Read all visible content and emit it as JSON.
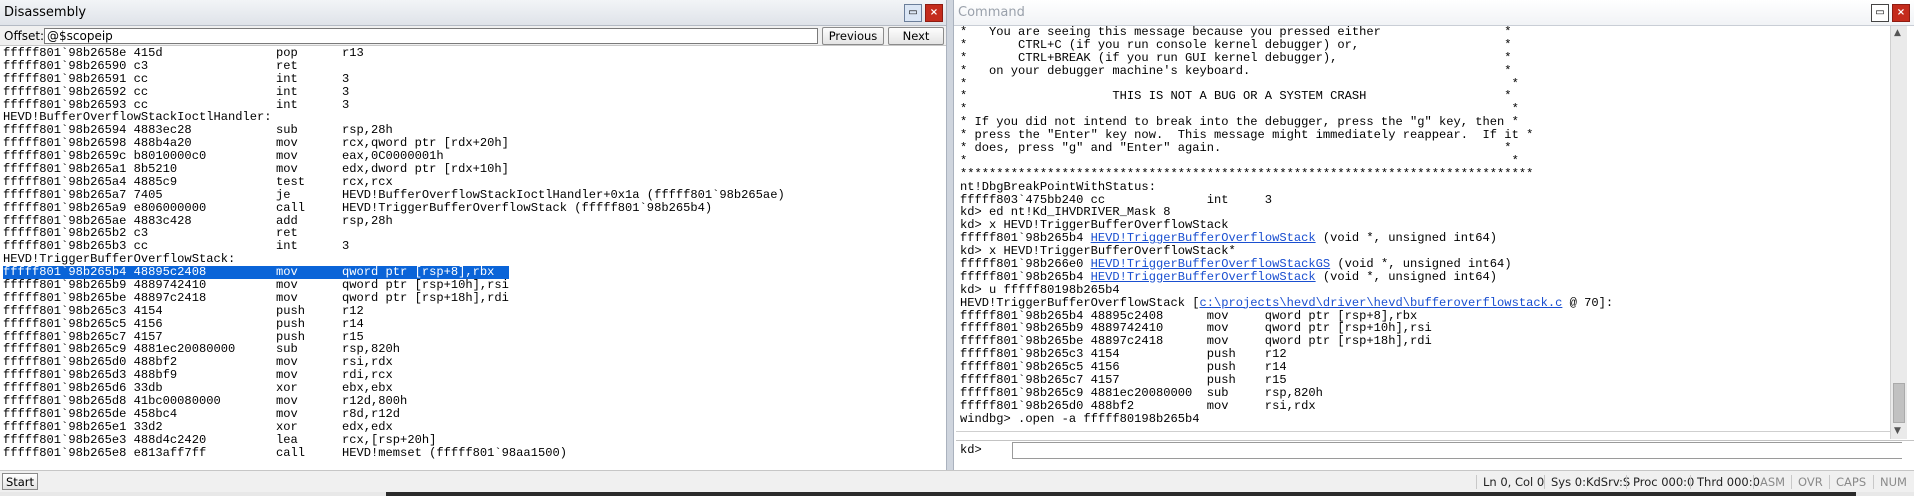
{
  "disassembly": {
    "title": "Disassembly",
    "offset_label": "Offset:",
    "offset_value": "@$scopeip",
    "prev_label": "Previous",
    "next_label": "Next",
    "dock_icon": "dock-window-icon",
    "close_icon": "close-icon",
    "lines": [
      {
        "a": "fffff801`98b2658e 415d",
        "m": "pop",
        "o": "r13"
      },
      {
        "a": "fffff801`98b26590 c3",
        "m": "ret",
        "o": ""
      },
      {
        "a": "fffff801`98b26591 cc",
        "m": "int",
        "o": "3"
      },
      {
        "a": "fffff801`98b26592 cc",
        "m": "int",
        "o": "3"
      },
      {
        "a": "fffff801`98b26593 cc",
        "m": "int",
        "o": "3"
      },
      {
        "t": "HEVD!BufferOverflowStackIoctlHandler:"
      },
      {
        "a": "fffff801`98b26594 4883ec28",
        "m": "sub",
        "o": "rsp,28h"
      },
      {
        "a": "fffff801`98b26598 488b4a20",
        "m": "mov",
        "o": "rcx,qword ptr [rdx+20h]"
      },
      {
        "a": "fffff801`98b2659c b8010000c0",
        "m": "mov",
        "o": "eax,0C0000001h"
      },
      {
        "a": "fffff801`98b265a1 8b5210",
        "m": "mov",
        "o": "edx,dword ptr [rdx+10h]"
      },
      {
        "a": "fffff801`98b265a4 4885c9",
        "m": "test",
        "o": "rcx,rcx"
      },
      {
        "a": "fffff801`98b265a7 7405",
        "m": "je",
        "o": "HEVD!BufferOverflowStackIoctlHandler+0x1a (fffff801`98b265ae)"
      },
      {
        "a": "fffff801`98b265a9 e806000000",
        "m": "call",
        "o": "HEVD!TriggerBufferOverflowStack (fffff801`98b265b4)"
      },
      {
        "a": "fffff801`98b265ae 4883c428",
        "m": "add",
        "o": "rsp,28h"
      },
      {
        "a": "fffff801`98b265b2 c3",
        "m": "ret",
        "o": ""
      },
      {
        "a": "fffff801`98b265b3 cc",
        "m": "int",
        "o": "3"
      },
      {
        "t": "HEVD!TriggerBufferOverflowStack:"
      },
      {
        "a": "fffff801`98b265b4 48895c2408",
        "m": "mov",
        "o": "qword ptr [rsp+8],rbx",
        "sel": true
      },
      {
        "a": "fffff801`98b265b9 4889742410",
        "m": "mov",
        "o": "qword ptr [rsp+10h],rsi"
      },
      {
        "a": "fffff801`98b265be 48897c2418",
        "m": "mov",
        "o": "qword ptr [rsp+18h],rdi"
      },
      {
        "a": "fffff801`98b265c3 4154",
        "m": "push",
        "o": "r12"
      },
      {
        "a": "fffff801`98b265c5 4156",
        "m": "push",
        "o": "r14"
      },
      {
        "a": "fffff801`98b265c7 4157",
        "m": "push",
        "o": "r15"
      },
      {
        "a": "fffff801`98b265c9 4881ec20080000",
        "m": "sub",
        "o": "rsp,820h"
      },
      {
        "a": "fffff801`98b265d0 488bf2",
        "m": "mov",
        "o": "rsi,rdx"
      },
      {
        "a": "fffff801`98b265d3 488bf9",
        "m": "mov",
        "o": "rdi,rcx"
      },
      {
        "a": "fffff801`98b265d6 33db",
        "m": "xor",
        "o": "ebx,ebx"
      },
      {
        "a": "fffff801`98b265d8 41bc00080000",
        "m": "mov",
        "o": "r12d,800h"
      },
      {
        "a": "fffff801`98b265de 458bc4",
        "m": "mov",
        "o": "r8d,r12d"
      },
      {
        "a": "fffff801`98b265e1 33d2",
        "m": "xor",
        "o": "edx,edx"
      },
      {
        "a": "fffff801`98b265e3 488d4c2420",
        "m": "lea",
        "o": "rcx,[rsp+20h]"
      },
      {
        "a": "fffff801`98b265e8 e813aff7ff",
        "m": "call",
        "o": "HEVD!memset (fffff801`98aa1500)"
      }
    ]
  },
  "command": {
    "title": "Command",
    "dock_icon": "dock-window-icon",
    "lines": [
      [
        {
          "t": "*   You are seeing this message because you pressed either                 *"
        }
      ],
      [
        {
          "t": "*       CTRL+C (if you run console kernel debugger) or,                    *"
        }
      ],
      [
        {
          "t": "*       CTRL+BREAK (if you run GUI kernel debugger),                       *"
        }
      ],
      [
        {
          "t": "*   on your debugger machine's keyboard.                                   *"
        }
      ],
      [
        {
          "t": "*                                                                           *"
        }
      ],
      [
        {
          "t": "*                    THIS IS NOT A BUG OR A SYSTEM CRASH                   *"
        }
      ],
      [
        {
          "t": "*                                                                           *"
        }
      ],
      [
        {
          "t": "* If you did not intend to break into the debugger, press the \"g\" key, then *"
        }
      ],
      [
        {
          "t": "* press the \"Enter\" key now.  This message might immediately reappear.  If it *"
        }
      ],
      [
        {
          "t": "* does, press \"g\" and \"Enter\" again.                                       *"
        }
      ],
      [
        {
          "t": "*                                                                           *"
        }
      ],
      [
        {
          "t": "*******************************************************************************"
        }
      ],
      [
        {
          "t": "nt!DbgBreakPointWithStatus:"
        }
      ],
      [
        {
          "t": "fffff803`475bb240 cc              int     3"
        }
      ],
      [
        {
          "t": "kd> ed nt!Kd_IHVDRIVER_Mask 8"
        }
      ],
      [
        {
          "t": "kd> x HEVD!TriggerBufferOverflowStack"
        }
      ],
      [
        {
          "t": "fffff801`98b265b4 "
        },
        {
          "t": "HEVD!TriggerBufferOverflowStack",
          "link": true
        },
        {
          "t": " (void *, unsigned int64)"
        }
      ],
      [
        {
          "t": "kd> x HEVD!TriggerBufferOverflowStack*"
        }
      ],
      [
        {
          "t": "fffff801`98b266e0 "
        },
        {
          "t": "HEVD!TriggerBufferOverflowStackGS",
          "link": true
        },
        {
          "t": " (void *, unsigned int64)"
        }
      ],
      [
        {
          "t": "fffff801`98b265b4 "
        },
        {
          "t": "HEVD!TriggerBufferOverflowStack",
          "link": true
        },
        {
          "t": " (void *, unsigned int64)"
        }
      ],
      [
        {
          "t": "kd> u fffff80198b265b4"
        }
      ],
      [
        {
          "t": "HEVD!TriggerBufferOverflowStack ["
        },
        {
          "t": "c:\\projects\\hevd\\driver\\hevd\\bufferoverflowstack.c",
          "link": true
        },
        {
          "t": " @ 70]:"
        }
      ],
      [
        {
          "t": "fffff801`98b265b4 48895c2408      mov     qword ptr [rsp+8],rbx"
        }
      ],
      [
        {
          "t": "fffff801`98b265b9 4889742410      mov     qword ptr [rsp+10h],rsi"
        }
      ],
      [
        {
          "t": "fffff801`98b265be 48897c2418      mov     qword ptr [rsp+18h],rdi"
        }
      ],
      [
        {
          "t": "fffff801`98b265c3 4154            push    r12"
        }
      ],
      [
        {
          "t": "fffff801`98b265c5 4156            push    r14"
        }
      ],
      [
        {
          "t": "fffff801`98b265c7 4157            push    r15"
        }
      ],
      [
        {
          "t": "fffff801`98b265c9 4881ec20080000  sub     rsp,820h"
        }
      ],
      [
        {
          "t": "fffff801`98b265d0 488bf2          mov     rsi,rdx"
        }
      ],
      [
        {
          "t": "windbg> .open -a fffff80198b265b4"
        }
      ]
    ],
    "prompt": "kd>",
    "input_value": ""
  },
  "statusbar": {
    "start_label": "Start",
    "ln_col": "Ln 0, Col 0",
    "sys": "Sys 0:KdSrv:S",
    "proc": "Proc 000:0",
    "thrd": "Thrd 000:0",
    "asm": "ASM",
    "ovr": "OVR",
    "caps": "CAPS",
    "num": "NUM"
  }
}
